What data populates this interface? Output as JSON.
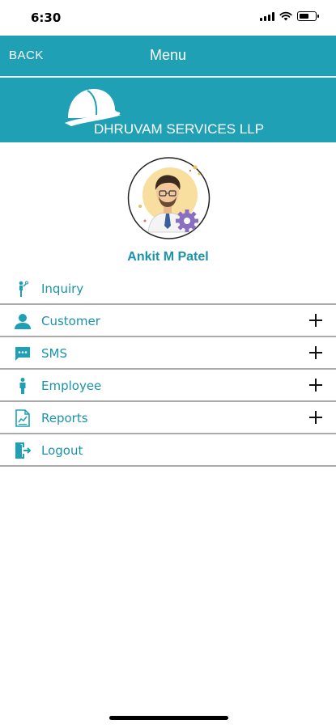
{
  "status_bar": {
    "time": "6:30",
    "icons": [
      "signal-icon",
      "wifi-icon",
      "battery-icon"
    ]
  },
  "nav": {
    "back_label": "BACK",
    "title": "Menu"
  },
  "banner": {
    "logo_icon": "helmet-logo",
    "brand_name": "DHRUVAM SERVICES LLP"
  },
  "profile": {
    "avatar_icon": "user-avatar-with-gear",
    "name": "Ankit M Patel"
  },
  "menu": {
    "items": [
      {
        "label": "Inquiry",
        "icon": "inquiry-icon",
        "expandable": false
      },
      {
        "label": "Customer",
        "icon": "person-icon",
        "expandable": true
      },
      {
        "label": "SMS",
        "icon": "chat-icon",
        "expandable": true
      },
      {
        "label": "Employee",
        "icon": "employee-icon",
        "expandable": true
      },
      {
        "label": "Reports",
        "icon": "report-icon",
        "expandable": true
      },
      {
        "label": "Logout",
        "icon": "logout-icon",
        "expandable": false
      }
    ]
  },
  "colors": {
    "accent": "#1fa0b5",
    "text_accent": "#1a93aa",
    "divider": "#a9a9a9"
  }
}
